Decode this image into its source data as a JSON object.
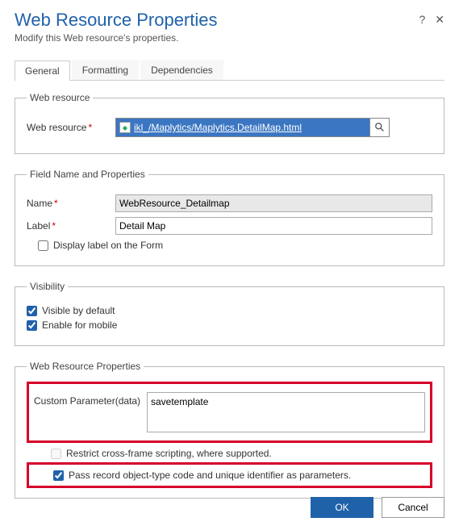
{
  "header": {
    "title": "Web Resource Properties",
    "subtitle": "Modify this Web resource's properties."
  },
  "tabs": {
    "general": "General",
    "formatting": "Formatting",
    "dependencies": "Dependencies"
  },
  "section_webresource": {
    "legend": "Web resource",
    "label": "Web resource",
    "value": "ikl_/Maplytics/Maplytics.DetailMap.html"
  },
  "section_field": {
    "legend": "Field Name and Properties",
    "name_label": "Name",
    "name_value": "WebResource_Detailmap",
    "label_label": "Label",
    "label_value": "Detail Map",
    "display_label_chk": "Display label on the Form"
  },
  "section_visibility": {
    "legend": "Visibility",
    "visible_chk": "Visible by default",
    "mobile_chk": "Enable for mobile"
  },
  "section_props": {
    "legend": "Web Resource Properties",
    "custom_param_label": "Custom Parameter(data)",
    "custom_param_value": "savetemplate",
    "restrict_chk": "Restrict cross-frame scripting, where supported.",
    "pass_record_chk": "Pass record object-type code and unique identifier as parameters."
  },
  "buttons": {
    "ok": "OK",
    "cancel": "Cancel"
  }
}
